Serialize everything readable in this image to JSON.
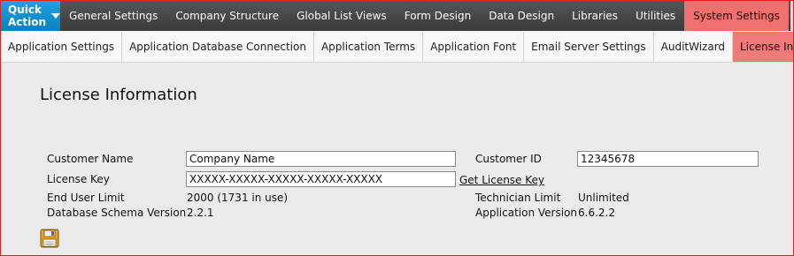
{
  "topnav": {
    "quick_action": "Quick Action",
    "items": [
      "General Settings",
      "Company Structure",
      "Global List Views",
      "Form Design",
      "Data Design",
      "Libraries",
      "Utilities",
      "System Settings"
    ]
  },
  "subnav": {
    "items": [
      "Application Settings",
      "Application Database Connection",
      "Application Terms",
      "Application Font",
      "Email Server Settings",
      "AuditWizard",
      "License Information"
    ]
  },
  "page": {
    "title": "License Information"
  },
  "form": {
    "customer_name_label": "Customer Name",
    "customer_name_value": "Company Name",
    "customer_id_label": "Customer ID",
    "customer_id_value": "12345678",
    "license_key_label": "License Key",
    "license_key_value": "XXXXX-XXXXX-XXXXX-XXXXX-XXXXX",
    "get_license_key": "Get License Key",
    "end_user_limit_label": "End User Limit",
    "end_user_limit_value": "2000 (1731 in use)",
    "technician_limit_label": "Technician Limit",
    "technician_limit_value": "Unlimited",
    "db_schema_label": "Database Schema Version",
    "db_schema_value": "2.2.1",
    "app_version_label": "Application Version",
    "app_version_value": "6.6.2.2"
  },
  "icons": {
    "save": "save-icon",
    "dropdown": "chevron-down-icon"
  },
  "colors": {
    "accent": "#1188cc",
    "active_tab": "#f07070",
    "border": "#e32020"
  }
}
